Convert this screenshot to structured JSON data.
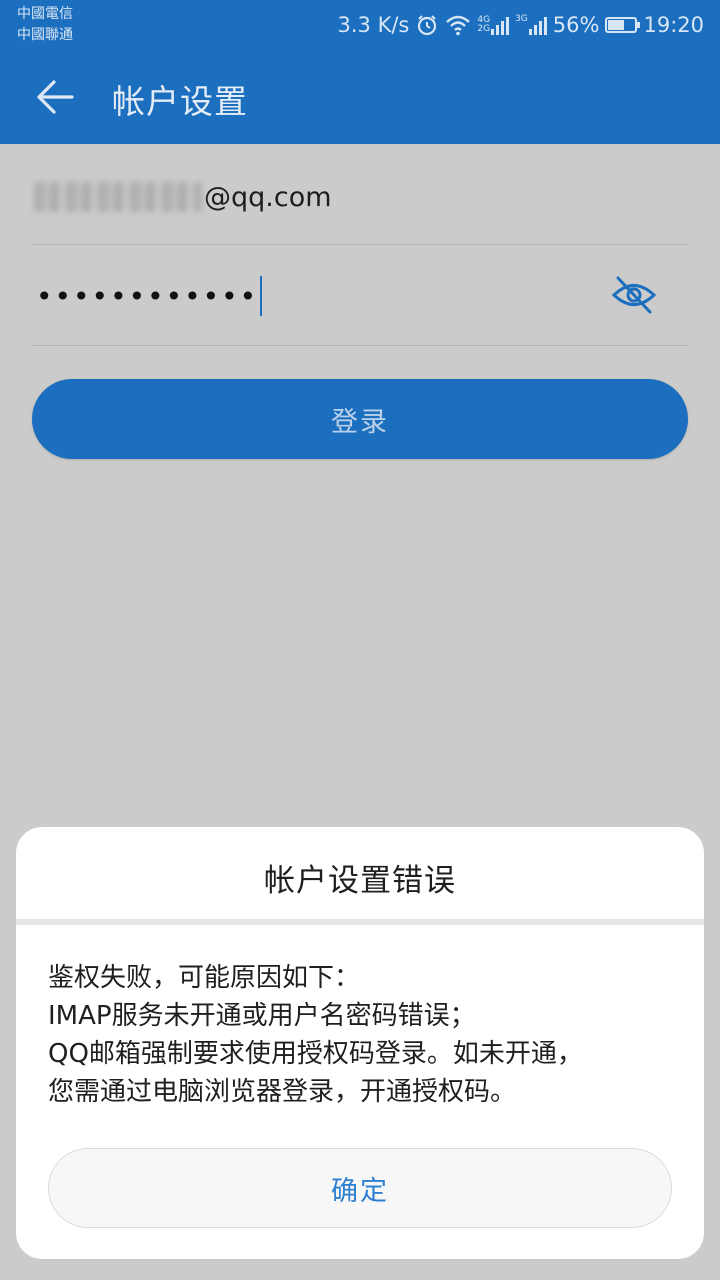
{
  "status_bar": {
    "carrier_1": "中國電信",
    "carrier_2": "中國聯通",
    "network_speed": "3.3 K/s",
    "network_4g": "4G",
    "network_2g": "2G",
    "network_3g": "3G",
    "battery_percent": "56%",
    "time": "19:20",
    "icons": [
      "alarm-icon",
      "wifi-icon",
      "signal-icon",
      "battery-icon"
    ]
  },
  "toolbar": {
    "title": "帐户设置",
    "back_icon": "arrow-left-icon"
  },
  "form": {
    "email_domain": "@qq.com",
    "password_masked": "••••••••••••",
    "visibility_icon": "eye-off-icon",
    "login_label": "登录"
  },
  "dialog": {
    "title": "帐户设置错误",
    "message_lines": [
      "鉴权失败，可能原因如下：",
      "IMAP服务未开通或用户名密码错误；",
      "QQ邮箱强制要求使用授权码登录。如未开通，",
      "您需通过电脑浏览器登录，开通授权码。"
    ],
    "ok_label": "确定"
  },
  "colors": {
    "primary": "#1c6fbf",
    "scrim_background": "#cbcbcb",
    "dialog_button_text": "#2d7fd0"
  }
}
